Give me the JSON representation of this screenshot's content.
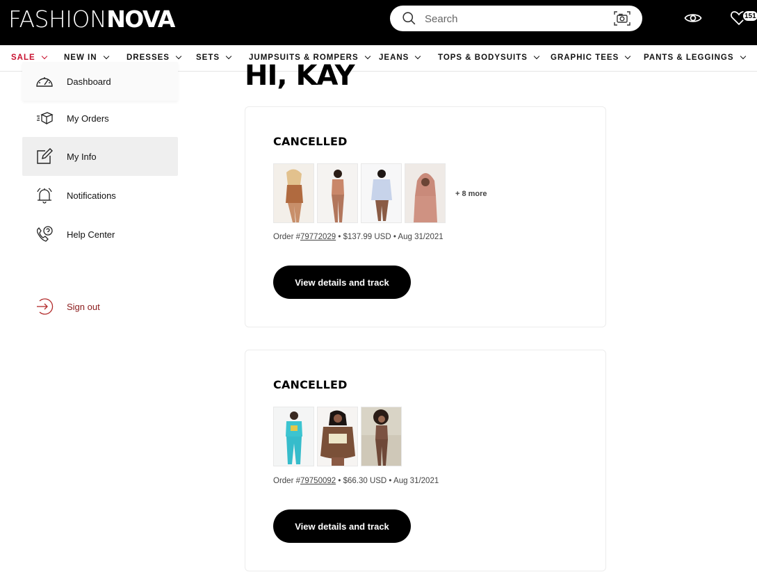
{
  "header": {
    "logo_light": "FASHION",
    "logo_bold": "NOVA",
    "search_placeholder": "Search",
    "wishlist_count": "151"
  },
  "nav": [
    {
      "label": "SALE",
      "accent": "#c8102e"
    },
    {
      "label": "NEW IN"
    },
    {
      "label": "DRESSES"
    },
    {
      "label": "SETS"
    },
    {
      "label": "JUMPSUITS & ROMPERS"
    },
    {
      "label": "JEANS"
    },
    {
      "label": "TOPS & BODYSUITS"
    },
    {
      "label": "GRAPHIC TEES"
    },
    {
      "label": "PANTS & LEGGINGS"
    }
  ],
  "sidebar": {
    "items": [
      {
        "label": "Dashboard",
        "icon": "speedometer-icon"
      },
      {
        "label": "My Orders",
        "icon": "package-icon"
      },
      {
        "label": "My Info",
        "icon": "edit-icon"
      },
      {
        "label": "Notifications",
        "icon": "bell-icon"
      },
      {
        "label": "Help Center",
        "icon": "phone-help-icon"
      }
    ],
    "signout": {
      "label": "Sign out",
      "icon": "sign-out-icon"
    }
  },
  "main": {
    "greeting": "HI, KAY",
    "orders": [
      {
        "status": "CANCELLED",
        "more": "+ 8 more",
        "order_prefix": "Order #",
        "order_number": "79772029",
        "details": " • $137.99 USD • Aug 31/2021",
        "button": "View details and track"
      },
      {
        "status": "CANCELLED",
        "more": "",
        "order_prefix": "Order #",
        "order_number": "79750092",
        "details": " • $66.30 USD • Aug 31/2021",
        "button": "View details and track"
      }
    ]
  },
  "colors": {
    "header_bg": "#000000",
    "sale_accent": "#c8102e",
    "signout_text": "#8a1a1a",
    "active_item_bg": "#efefef"
  }
}
